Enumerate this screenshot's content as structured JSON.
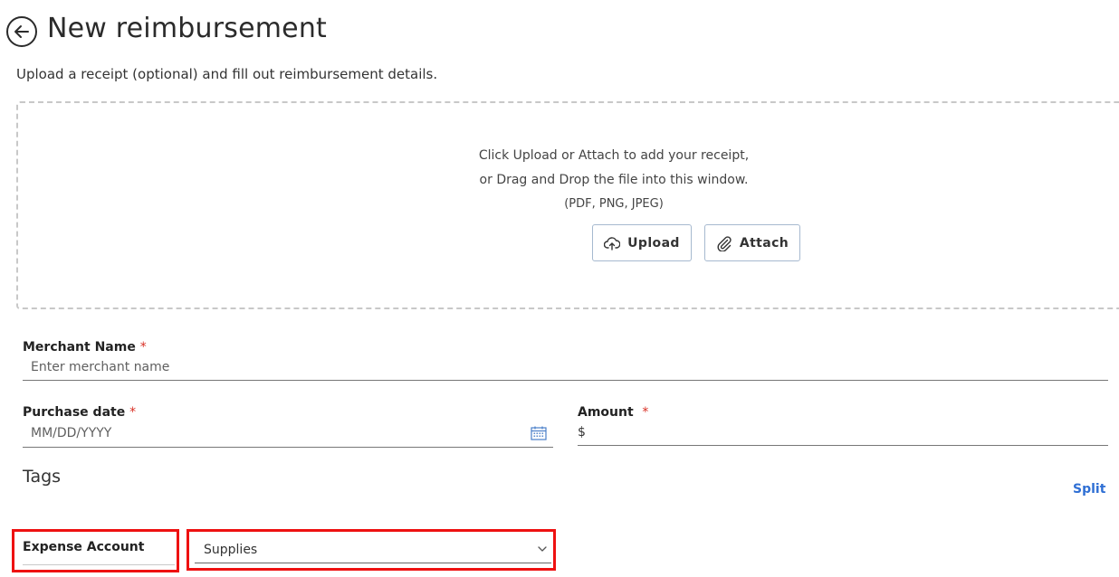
{
  "header": {
    "title": "New reimbursement",
    "subtitle": "Upload a receipt (optional) and fill out reimbursement details."
  },
  "dropzone": {
    "line1": "Click Upload or Attach to add your receipt,",
    "line2": "or Drag and Drop the file into this window.",
    "formats": "(PDF, PNG, JPEG)",
    "upload_label": "Upload",
    "attach_label": "Attach"
  },
  "form": {
    "merchant": {
      "label": "Merchant Name",
      "required": "*",
      "placeholder": "Enter merchant name",
      "value": ""
    },
    "purchase_date": {
      "label": "Purchase date",
      "required": "*",
      "placeholder": "MM/DD/YYYY",
      "value": ""
    },
    "amount": {
      "label": "Amount",
      "required": "*",
      "prefix": "$",
      "value": ""
    }
  },
  "tags": {
    "heading": "Tags",
    "split_label": "Split",
    "expense_account": {
      "label": "Expense Account",
      "selected": "Supplies"
    }
  },
  "colors": {
    "accent": "#2f6fd4",
    "required": "#d93025",
    "highlight": "#ee1111"
  },
  "icons": {
    "back": "arrow-left-circle-icon",
    "upload": "cloud-upload-icon",
    "attach": "paperclip-icon",
    "calendar": "calendar-icon",
    "chevron": "chevron-down-icon"
  }
}
